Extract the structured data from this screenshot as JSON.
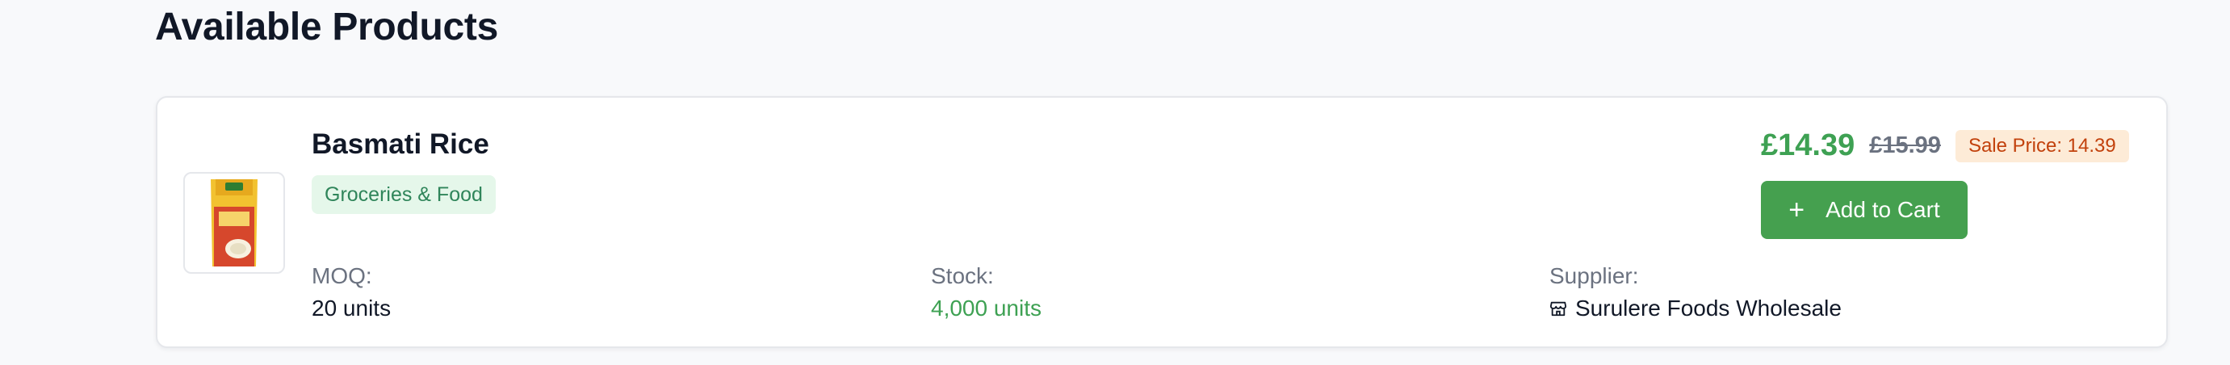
{
  "section": {
    "title": "Available Products"
  },
  "product": {
    "name": "Basmati Rice",
    "category": "Groceries & Food",
    "moq_label": "MOQ:",
    "moq_value": "20 units",
    "stock_label": "Stock:",
    "stock_value": "4,000 units",
    "supplier_label": "Supplier:",
    "supplier_value": "Surulere Foods Wholesale",
    "supplier_icon": "store-icon",
    "price_current": "£14.39",
    "price_original": "£15.99",
    "sale_badge": "Sale Price: 14.39",
    "add_to_cart_label": "Add to Cart",
    "add_icon": "plus-icon"
  },
  "colors": {
    "accent_green": "#45a04f",
    "price_green": "#3ea153",
    "sale_badge_bg": "#fdebd7",
    "sale_badge_text": "#c2410c",
    "category_badge_bg": "#e5f7ea"
  }
}
